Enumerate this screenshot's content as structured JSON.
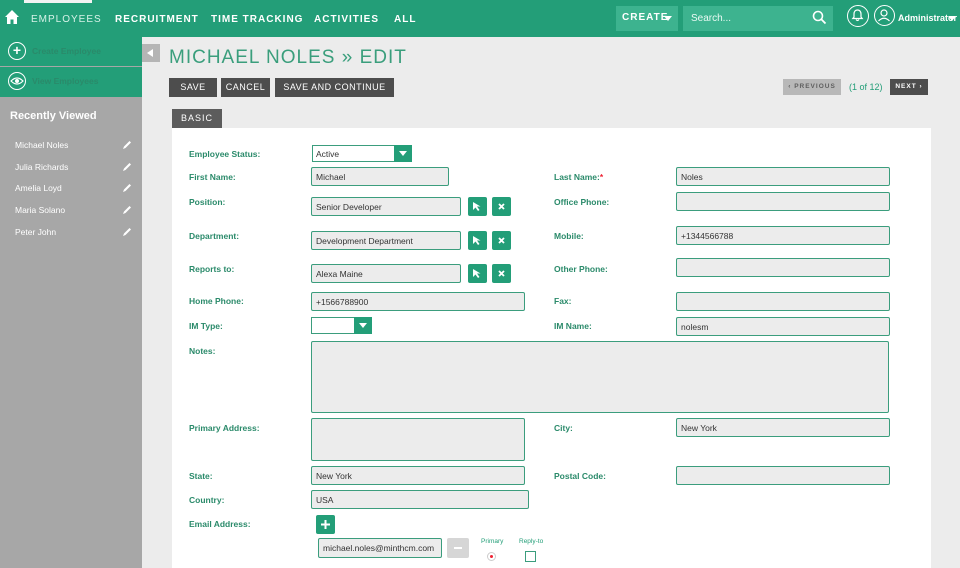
{
  "nav": {
    "items": [
      "EMPLOYEES",
      "RECRUITMENT",
      "TIME TRACKING",
      "ACTIVITIES",
      "ALL"
    ],
    "create_label": "CREATE",
    "search_placeholder": "Search...",
    "user_name": "Administrator"
  },
  "sidebar": {
    "create_label": "Create Employee",
    "view_label": "View Employees",
    "recent_title": "Recently Viewed",
    "recent": [
      "Michael Noles",
      "Julia Richards",
      "Amelia Loyd",
      "Maria Solano",
      "Peter John"
    ]
  },
  "page": {
    "title": "MICHAEL NOLES » EDIT",
    "save": "SAVE",
    "cancel": "CANCEL",
    "save_continue": "SAVE AND CONTINUE",
    "previous": "PREVIOUS",
    "pager": "(1 of 12)",
    "next": "NEXT",
    "tab": "BASIC"
  },
  "form": {
    "employee_status": {
      "label": "Employee Status:",
      "value": "Active"
    },
    "first_name": {
      "label": "First Name:",
      "value": "Michael"
    },
    "last_name": {
      "label": "Last Name:",
      "value": "Noles",
      "required": "*"
    },
    "position": {
      "label": "Position:",
      "value": "Senior Developer"
    },
    "office_phone": {
      "label": "Office Phone:",
      "value": ""
    },
    "department": {
      "label": "Department:",
      "value": "Development Department"
    },
    "mobile": {
      "label": "Mobile:",
      "value": "+1344566788"
    },
    "reports_to": {
      "label": "Reports to:",
      "value": "Alexa Maine"
    },
    "other_phone": {
      "label": "Other Phone:",
      "value": ""
    },
    "home_phone": {
      "label": "Home Phone:",
      "value": "+1566788900"
    },
    "fax": {
      "label": "Fax:",
      "value": ""
    },
    "im_type": {
      "label": "IM Type:",
      "value": ""
    },
    "im_name": {
      "label": "IM Name:",
      "value": "nolesm"
    },
    "notes": {
      "label": "Notes:",
      "value": ""
    },
    "primary_address": {
      "label": "Primary Address:",
      "value": ""
    },
    "city": {
      "label": "City:",
      "value": "New York"
    },
    "state": {
      "label": "State:",
      "value": "New York"
    },
    "postal_code": {
      "label": "Postal Code:",
      "value": ""
    },
    "country": {
      "label": "Country:",
      "value": "USA"
    },
    "email": {
      "label": "Email Address:",
      "value": "michael.noles@minthcm.com",
      "primary_label": "Primary",
      "reply_label": "Reply-to"
    }
  },
  "colors": {
    "brand": "#239e78",
    "sidebar": "#a7a7a7",
    "dark_button": "#4d4d4d"
  }
}
